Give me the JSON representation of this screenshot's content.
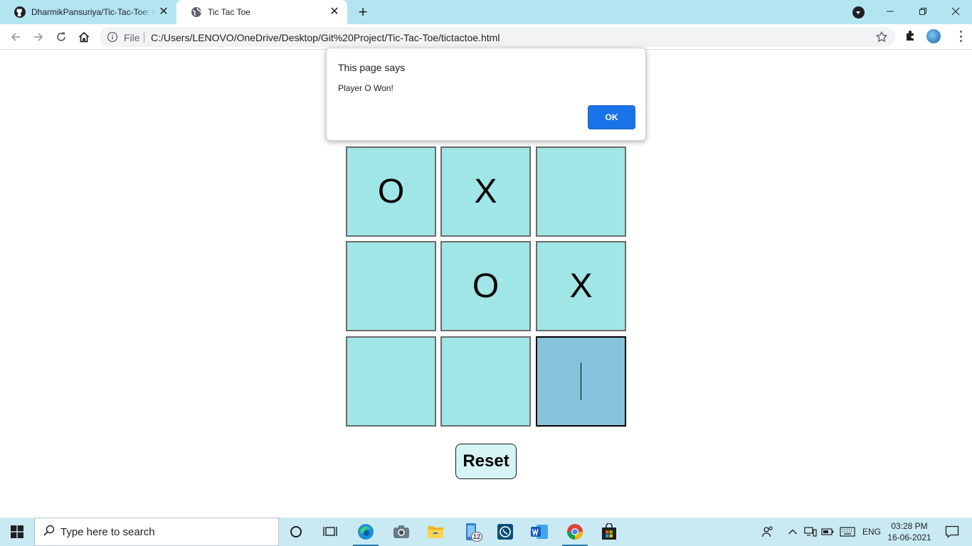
{
  "browser": {
    "tabs": [
      {
        "title": "DharmikPansuriya/Tic-Tac-Toe: I c",
        "icon": "github-icon",
        "active": false
      },
      {
        "title": "Tic Tac Toe",
        "icon": "globe-icon",
        "active": true
      }
    ],
    "omnibox": {
      "scheme_label": "File",
      "url": "C:/Users/LENOVO/OneDrive/Desktop/Git%20Project/Tic-Tac-Toe/tictactoe.html"
    }
  },
  "dialog": {
    "title": "This page says",
    "message": "Player O Won!",
    "ok_label": "OK"
  },
  "game": {
    "cells": [
      "O",
      "X",
      "",
      "",
      "O",
      "X",
      "",
      "",
      ""
    ],
    "focused_cell": 8,
    "reset_label": "Reset",
    "colors": {
      "cell": "#a0e6e6",
      "cell_focused": "#86c4dc",
      "reset_bg": "#d6f4f6"
    }
  },
  "taskbar": {
    "search_placeholder": "Type here to search",
    "apps": [
      "cortana-icon",
      "task-view-icon",
      "edge-icon",
      "camera-icon",
      "file-explorer-icon",
      "phone-icon",
      "whatsapp-icon",
      "word-icon",
      "chrome-icon",
      "store-icon"
    ],
    "phone_badge": "12",
    "language": "ENG",
    "time": "03:28 PM",
    "date": "16-06-2021"
  }
}
